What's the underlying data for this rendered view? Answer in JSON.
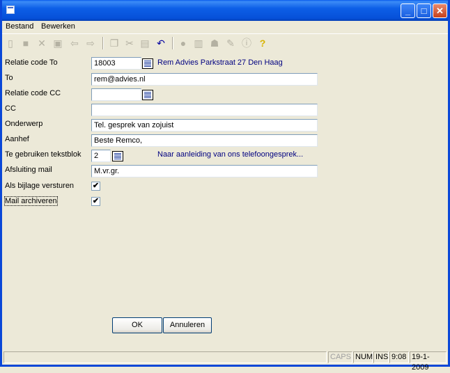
{
  "menu": {
    "bestand": "Bestand",
    "bewerken": "Bewerken"
  },
  "form": {
    "relatie_to_label": "Relatie code To",
    "relatie_to_value": "18003",
    "relatie_to_info": "Rem Advies Parkstraat 27 Den Haag",
    "to_label": "To",
    "to_value": "rem@advies.nl",
    "relatie_cc_label": "Relatie code CC",
    "relatie_cc_value": "",
    "cc_label": "CC",
    "cc_value": "",
    "onderwerp_label": "Onderwerp",
    "onderwerp_value": "Tel. gesprek van zojuist",
    "aanhef_label": "Aanhef",
    "aanhef_value": "Beste Remco,",
    "tekstblok_label": "Te gebruiken tekstblok",
    "tekstblok_value": "2",
    "tekstblok_info": "Naar aanleiding van ons telefoongesprek...",
    "afsluiting_label": "Afsluiting mail",
    "afsluiting_value": "M.vr.gr.",
    "bijlage_label": "Als bijlage versturen",
    "bijlage_check": "✔",
    "archiveren_label": "Mail archiveren",
    "archiveren_check": "✔"
  },
  "buttons": {
    "ok": "OK",
    "annuleren": "Annuleren"
  },
  "status": {
    "caps": "CAPS",
    "num": "NUM",
    "ins": "INS",
    "time": "9:08",
    "date": "19-1-2009"
  },
  "title_buttons": {
    "minimize": "_",
    "maximize": "□",
    "close": "✕"
  },
  "icons": [
    "new-icon",
    "save-icon",
    "delete-icon",
    "saveas-icon",
    "back-icon",
    "forward-icon",
    "copy-icon",
    "cut-icon",
    "paste-icon",
    "undo-icon",
    "find-icon",
    "print-icon",
    "user-icon",
    "edit-icon",
    "info-icon",
    "help-icon"
  ],
  "colors": {
    "titlebar": "#0d5fe7",
    "info_text": "#000080",
    "window_bg": "#ece9d8"
  }
}
